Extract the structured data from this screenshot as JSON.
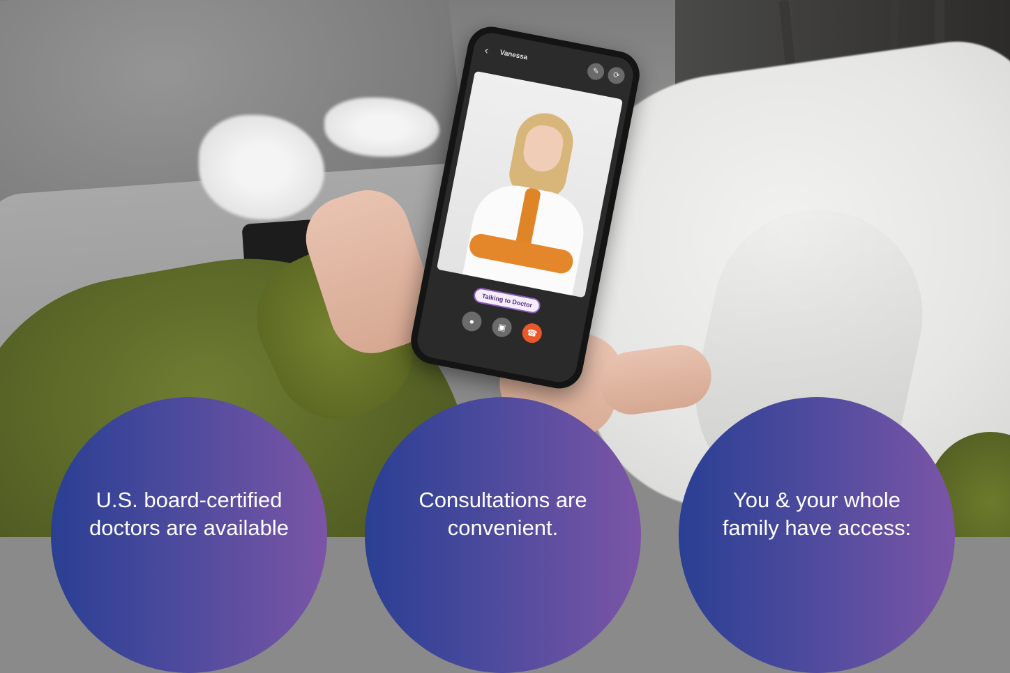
{
  "phone": {
    "caller_name": "Vanessa",
    "back_icon": "chevron-left-icon",
    "top_buttons": [
      "edit-icon",
      "switch-camera-icon"
    ],
    "call_status": "Talking to Doctor",
    "controls": [
      {
        "icon": "microphone-icon",
        "color": "#6b6b6b"
      },
      {
        "icon": "video-icon",
        "color": "#6b6b6b"
      },
      {
        "icon": "end-call-icon",
        "color": "#e8582a"
      }
    ]
  },
  "circles": [
    {
      "text": "U.S. board-certified doctors are available"
    },
    {
      "text": "Consultations are convenient."
    },
    {
      "text": "You & your whole family have access:"
    }
  ],
  "colors": {
    "circle_gradient_start": "#2a3f93",
    "circle_gradient_end": "#7b55a6",
    "end_call": "#e8582a",
    "call_status_text": "#5b2d7a"
  }
}
